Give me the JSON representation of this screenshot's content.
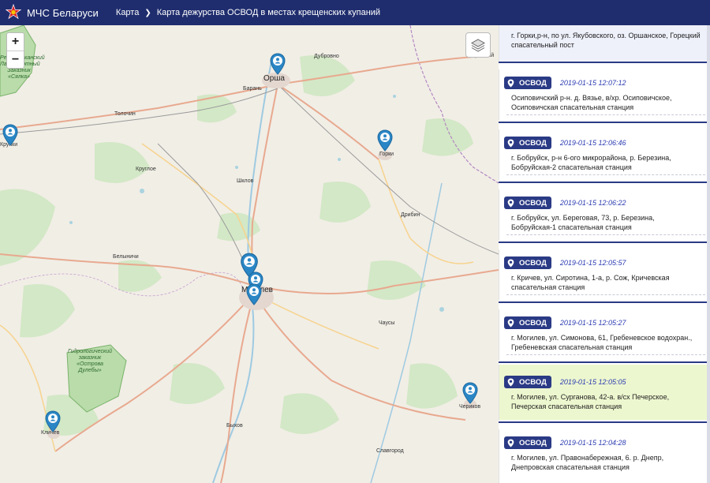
{
  "header": {
    "brand": "МЧС Беларуси",
    "breadcrumb": [
      "Карта",
      "Карта дежурства ОСВОД в местах крещенских купаний"
    ]
  },
  "map": {
    "zoom_in": "+",
    "zoom_out": "−",
    "cities": [
      "Орша",
      "Могилев"
    ],
    "towns": [
      "Дубровно",
      "Барань",
      "Толочин",
      "Крупки",
      "Круглое",
      "Шклов",
      "Горки",
      "Дрибин",
      "Белыничи",
      "Чаусы",
      "Быхов",
      "Кличев",
      "Чериков",
      "Славгород",
      "Красный"
    ],
    "reserves": [
      {
        "lines": [
          "Республиканский",
          "Ландшафтный",
          "Заказник",
          "«Сялка»"
        ]
      },
      {
        "lines": [
          "Гидрологический",
          "заказник",
          "«Острова",
          "Дулебы»"
        ]
      }
    ]
  },
  "sidebar": {
    "first_card_text": "г. Горки,р-н, по ул. Якубовского, оз. Оршанское, Горецкий спасательный пост",
    "cards": [
      {
        "badge": "ОСВОД",
        "time": "2019-01-15 12:07:12",
        "text": "Осиповичский р-н. д. Вязье, в/хр. Осиповичское, Осиповичская спасательная станция"
      },
      {
        "badge": "ОСВОД",
        "time": "2019-01-15 12:06:46",
        "text": "г. Бобруйск, р-н 6-ого микрорайона, р. Березина, Бобруйская-2 спасательная станция"
      },
      {
        "badge": "ОСВОД",
        "time": "2019-01-15 12:06:22",
        "text": "г. Бобруйск, ул. Береговая, 73, р. Березина, Бобруйская-1 спасательная станция"
      },
      {
        "badge": "ОСВОД",
        "time": "2019-01-15 12:05:57",
        "text": "г. Кричев, ул. Сиротина, 1-а, р. Сож, Кричевская спасательная станция"
      },
      {
        "badge": "ОСВОД",
        "time": "2019-01-15 12:05:27",
        "text": "г. Могилев, ул. Симонова, 61, Гребеневское водохран., Гребеневская спасательная станция"
      },
      {
        "badge": "ОСВОД",
        "time": "2019-01-15 12:05:05",
        "text": "г. Могилев, ул. Сурганова, 42-а. в/сх Печерское, Печерская спасательная станция"
      },
      {
        "badge": "ОСВОД",
        "time": "2019-01-15 12:04:28",
        "text": "г. Могилев, ул. Правонабережная, 6. р. Днепр, Днепровская спасательная станция"
      }
    ]
  },
  "colors": {
    "header": "#1f2d6e",
    "badge": "#2a3a85",
    "marker": "#2b86c5",
    "active_card": "#edf7cf",
    "timestamp": "#2b3bb1"
  }
}
